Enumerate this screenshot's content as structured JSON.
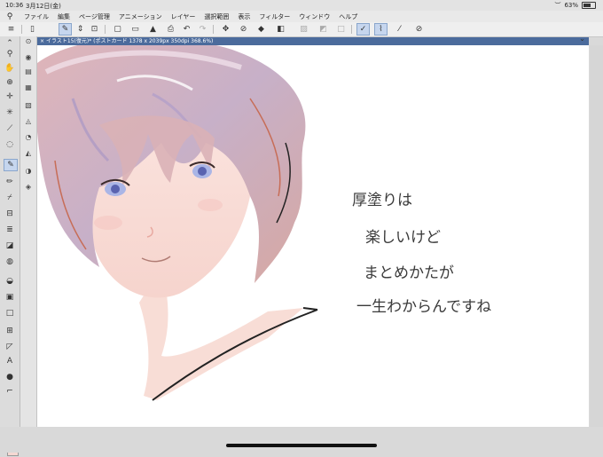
{
  "status_bar": {
    "time": "10:36",
    "date": "3月12日(金)",
    "battery": "63%"
  },
  "menu": {
    "items": [
      "ファイル",
      "編集",
      "ページ管理",
      "アニメーション",
      "レイヤー",
      "選択範囲",
      "表示",
      "フィルター",
      "ウィンドウ",
      "ヘルプ"
    ]
  },
  "document": {
    "tab_title": "イラスト15(復元)* (ポストカード 1378 x 2039px 350dpi 368.6%)"
  },
  "canvas": {
    "handwriting": [
      "厚塗りは",
      "楽しいけど",
      "まとめかたが",
      "一生わからんですね"
    ]
  },
  "colors": {
    "foreground": "#000000",
    "background": "#f5d8d2",
    "accent": "#4b6b9c"
  }
}
